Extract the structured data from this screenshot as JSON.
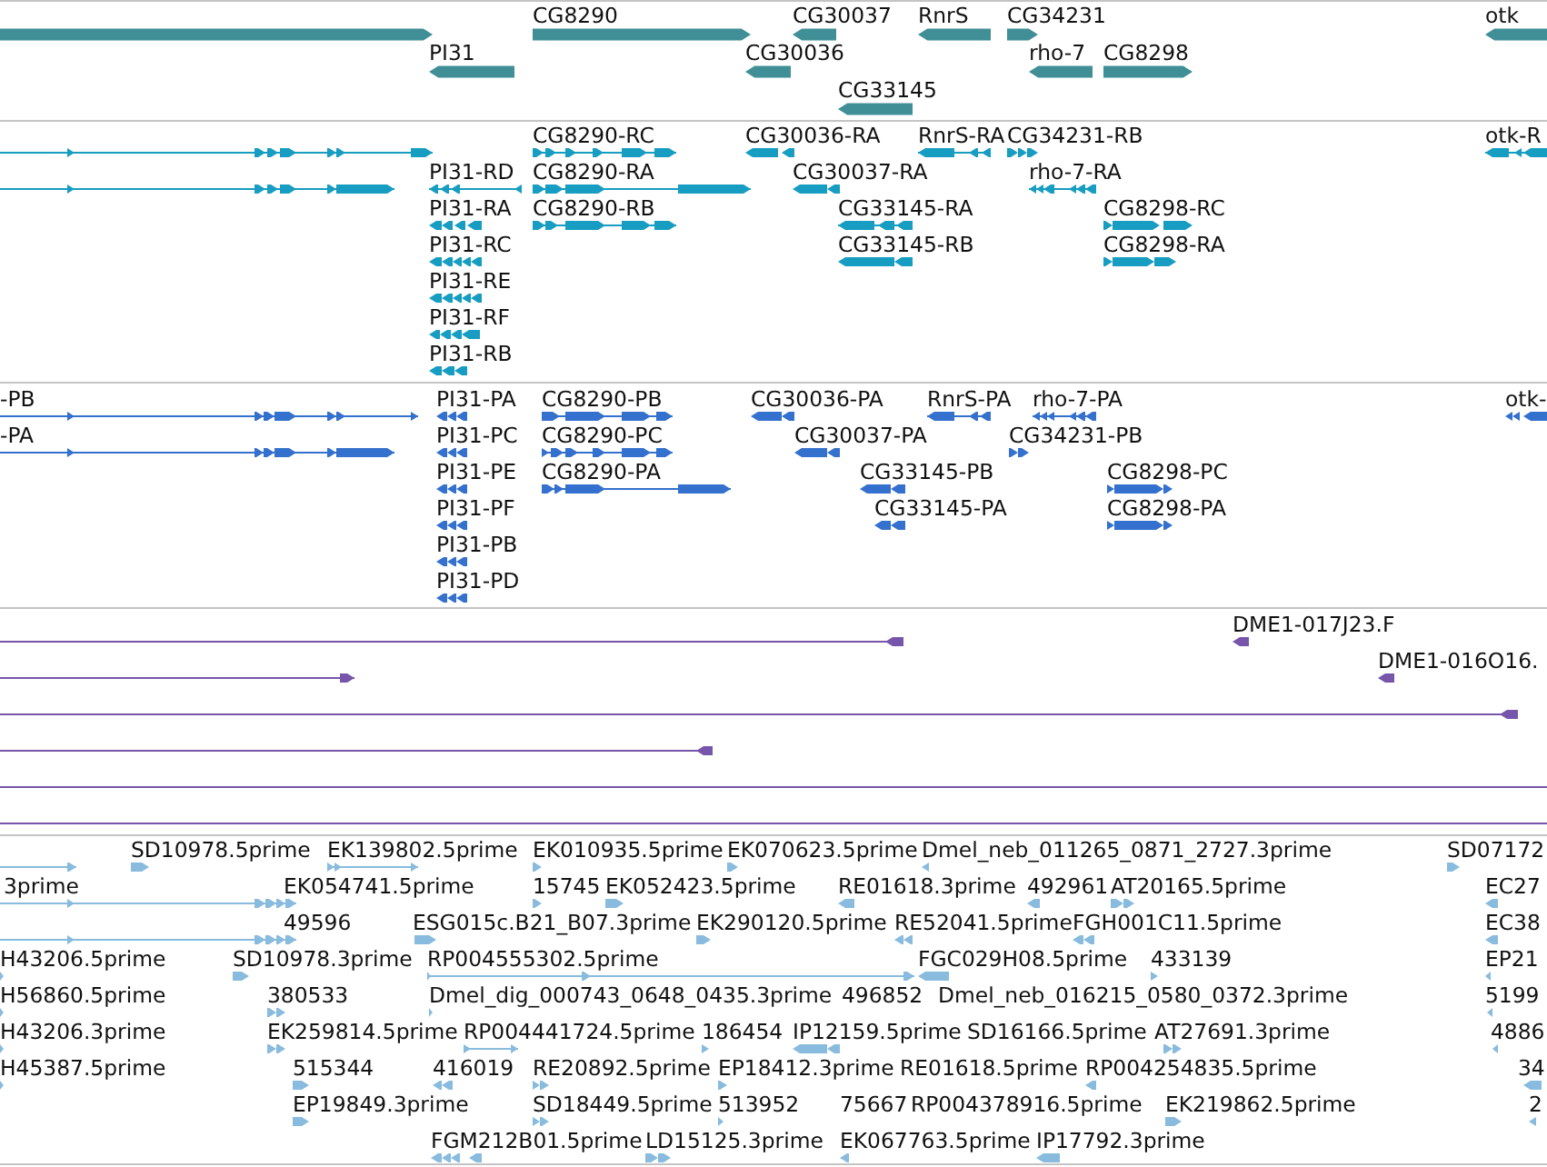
{
  "tracks": [
    {
      "kind": "gene",
      "features": [
        {
          "reverse": false
        },
        {
          "label": "CG8290",
          "reverse": false
        },
        {
          "label": "CG30037",
          "reverse": true
        },
        {
          "label": "RnrS",
          "reverse": true
        },
        {
          "label": "CG34231",
          "reverse": false
        },
        {
          "label": "otk",
          "reverse": true
        },
        {
          "label": "PI31",
          "reverse": true
        },
        {
          "label": "CG30036",
          "reverse": true
        },
        {
          "label": "rho-7",
          "reverse": true
        },
        {
          "label": "CG8298",
          "reverse": false
        },
        {
          "label": "CG33145",
          "reverse": true
        }
      ]
    },
    {
      "kind": "mrna",
      "features": [
        {
          "reverse": false
        },
        {
          "label": "CG8290-RC",
          "reverse": false
        },
        {
          "label": "CG30036-RA",
          "reverse": true
        },
        {
          "label": "RnrS-RA",
          "reverse": true
        },
        {
          "label": "CG34231-RB",
          "reverse": false
        },
        {
          "label": "otk-R",
          "reverse": true
        },
        {
          "reverse": false
        },
        {
          "label": "PI31-RD",
          "reverse": true
        },
        {
          "label": "CG8290-RA",
          "reverse": false
        },
        {
          "label": "CG30037-RA",
          "reverse": true
        },
        {
          "label": "rho-7-RA",
          "reverse": true
        },
        {
          "label": "PI31-RA",
          "reverse": true
        },
        {
          "label": "CG8290-RB",
          "reverse": false
        },
        {
          "label": "CG33145-RA",
          "reverse": true
        },
        {
          "label": "CG8298-RC",
          "reverse": false
        },
        {
          "label": "PI31-RC",
          "reverse": true
        },
        {
          "label": "CG33145-RB",
          "reverse": true
        },
        {
          "label": "CG8298-RA",
          "reverse": false
        },
        {
          "label": "PI31-RE",
          "reverse": true
        },
        {
          "label": "PI31-RF",
          "reverse": true
        },
        {
          "label": "PI31-RB",
          "reverse": true
        }
      ]
    },
    {
      "kind": "protein",
      "features": [
        {
          "label": "-PB",
          "reverse": false
        },
        {
          "label": "PI31-PA",
          "reverse": true
        },
        {
          "label": "CG8290-PB",
          "reverse": false
        },
        {
          "label": "CG30036-PA",
          "reverse": true
        },
        {
          "label": "RnrS-PA",
          "reverse": true
        },
        {
          "label": "rho-7-PA",
          "reverse": true
        },
        {
          "label": "otk-",
          "reverse": true
        },
        {
          "label": "-PA",
          "reverse": false
        },
        {
          "label": "PI31-PC",
          "reverse": true
        },
        {
          "label": "CG8290-PC",
          "reverse": false
        },
        {
          "label": "CG30037-PA",
          "reverse": true
        },
        {
          "label": "CG34231-PB",
          "reverse": false
        },
        {
          "label": "PI31-PE",
          "reverse": true
        },
        {
          "label": "CG8290-PA",
          "reverse": false
        },
        {
          "label": "CG33145-PB",
          "reverse": true
        },
        {
          "label": "CG8298-PC",
          "reverse": false
        },
        {
          "label": "PI31-PF",
          "reverse": true
        },
        {
          "label": "CG33145-PA",
          "reverse": true
        },
        {
          "label": "CG8298-PA",
          "reverse": false
        },
        {
          "label": "PI31-PB",
          "reverse": true
        },
        {
          "label": "PI31-PD",
          "reverse": true
        }
      ]
    },
    {
      "kind": "bac_end",
      "features": [
        {
          "reverse": true
        },
        {
          "label": "DME1-017J23.F",
          "reverse": true
        },
        {
          "reverse": false
        },
        {
          "label": "DME1-016O16.",
          "reverse": true
        },
        {
          "reverse": true
        },
        {
          "reverse": true
        }
      ]
    },
    {
      "kind": "est",
      "features": [
        {
          "reverse": false
        },
        {
          "label": "SD10978.5prime",
          "reverse": false
        },
        {
          "label": "EK139802.5prime",
          "reverse": false
        },
        {
          "label": "EK010935.5prime",
          "reverse": false
        },
        {
          "label": "EK070623.5prime",
          "reverse": false
        },
        {
          "label": "Dmel_neb_011265_0871_2727.3prime",
          "reverse": true
        },
        {
          "label": "SD07172",
          "reverse": false
        },
        {
          "label": "3prime",
          "reverse": false
        },
        {
          "label": "EK054741.5prime",
          "reverse": false
        },
        {
          "label": "15745",
          "reverse": false
        },
        {
          "label": "EK052423.5prime",
          "reverse": false
        },
        {
          "label": "RE01618.3prime",
          "reverse": true
        },
        {
          "label": "492961",
          "reverse": true
        },
        {
          "label": "AT20165.5prime",
          "reverse": false
        },
        {
          "label": "EC27",
          "reverse": true
        },
        {
          "reverse": false
        },
        {
          "label": "49596",
          "reverse": false
        },
        {
          "label": "ESG015c.B21_B07.3prime",
          "reverse": false
        },
        {
          "label": "EK290120.5prime",
          "reverse": false
        },
        {
          "label": "RE52041.5prime",
          "reverse": true
        },
        {
          "label": "FGH001C11.5prime",
          "reverse": true
        },
        {
          "label": "EC38",
          "reverse": true
        },
        {
          "label": "H43206.5prime",
          "reverse": false
        },
        {
          "label": "SD10978.3prime",
          "reverse": false
        },
        {
          "label": "RP004555302.5prime",
          "reverse": false
        },
        {
          "label": "FGC029H08.5prime",
          "reverse": true
        },
        {
          "label": "433139",
          "reverse": false
        },
        {
          "label": "EP21",
          "reverse": true
        },
        {
          "label": "H56860.5prime",
          "reverse": false
        },
        {
          "label": "380533",
          "reverse": false
        },
        {
          "label": "Dmel_dig_000743_0648_0435.3prime",
          "reverse": false
        },
        {
          "label": "496852"
        },
        {
          "label": "Dmel_neb_016215_0580_0372.3prime"
        },
        {
          "label": "5199",
          "reverse": true
        },
        {
          "label": "H43206.3prime",
          "reverse": false
        },
        {
          "label": "EK259814.5prime",
          "reverse": false
        },
        {
          "label": "RP004441724.5prime",
          "reverse": false
        },
        {
          "label": "186454",
          "reverse": false
        },
        {
          "label": "IP12159.5prime",
          "reverse": true
        },
        {
          "label": "SD16166.5prime"
        },
        {
          "label": "AT27691.3prime",
          "reverse": false
        },
        {
          "label": "4886",
          "reverse": true
        },
        {
          "label": "H45387.5prime",
          "reverse": false
        },
        {
          "label": "515344",
          "reverse": false
        },
        {
          "label": "416019",
          "reverse": true
        },
        {
          "label": "RE20892.5prime",
          "reverse": false
        },
        {
          "label": "EP18412.3prime",
          "reverse": false
        },
        {
          "label": "RE01618.5prime"
        },
        {
          "label": "RP004254835.5prime",
          "reverse": true
        },
        {
          "label": "34",
          "reverse": true
        },
        {
          "label": "EP19849.3prime",
          "reverse": false
        },
        {
          "label": "SD18449.5prime",
          "reverse": false
        },
        {
          "label": "513952",
          "reverse": false
        },
        {
          "label": "75667"
        },
        {
          "label": "RP004378916.5prime"
        },
        {
          "label": "EK219862.5prime",
          "reverse": false
        },
        {
          "label": "2",
          "reverse": true
        },
        {
          "label": "FGM212B01.5prime",
          "reverse": true
        },
        {
          "label": "LD15125.3prime",
          "reverse": false
        },
        {
          "label": "EK067763.5prime",
          "reverse": true
        },
        {
          "label": "IP17792.3prime",
          "reverse": true
        }
      ]
    }
  ]
}
